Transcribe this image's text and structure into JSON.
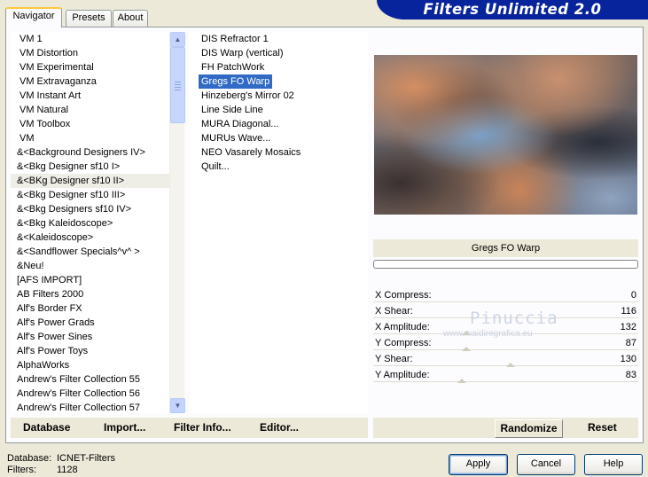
{
  "title_banner": "Filters Unlimited 2.0",
  "tabs": [
    {
      "label": "Navigator",
      "active": true
    },
    {
      "label": "Presets",
      "active": false
    },
    {
      "label": "About",
      "active": false
    }
  ],
  "categories": [
    "VM 1",
    "VM Distortion",
    "VM Experimental",
    "VM Extravaganza",
    "VM Instant Art",
    "VM Natural",
    "VM Toolbox",
    "VM",
    "&<Background Designers IV>",
    "&<Bkg Designer sf10 I>",
    "&<BKg Designer sf10 II>",
    "&<Bkg Designer sf10 III>",
    "&<Bkg Designers sf10 IV>",
    "&<Bkg Kaleidoscope>",
    "&<Kaleidoscope>",
    "&<Sandflower Specials^v^ >",
    "&Neu!",
    "[AFS IMPORT]",
    "AB Filters 2000",
    "Alf's Border FX",
    "Alf's Power Grads",
    "Alf's Power Sines",
    "Alf's Power Toys",
    "AlphaWorks",
    "Andrew's Filter Collection 55",
    "Andrew's Filter Collection 56",
    "Andrew's Filter Collection 57"
  ],
  "selected_category_index": 10,
  "filters": [
    "DIS Refractor 1",
    "DIS Warp (vertical)",
    "FH PatchWork",
    "Gregs FO Warp",
    "Hinzeberg's Mirror 02",
    "Line Side Line",
    "MURA Diagonal...",
    "MURUs Wave...",
    "NEO Vasarely Mosaics",
    "Quilt..."
  ],
  "selected_filter_index": 3,
  "current_filter_name": "Gregs FO Warp",
  "params": [
    {
      "label": "X Compress:",
      "value": "0"
    },
    {
      "label": "X Shear:",
      "value": "116"
    },
    {
      "label": "X Amplitude:",
      "value": "132"
    },
    {
      "label": "Y Compress:",
      "value": "87"
    },
    {
      "label": "Y Shear:",
      "value": "130"
    },
    {
      "label": "Y Amplitude:",
      "value": "83"
    }
  ],
  "watermark": {
    "name": "Pinuccia",
    "site": "www.maidiregrafica.eu"
  },
  "bottom_buttons": {
    "database": "Database",
    "import": "Import...",
    "filter_info": "Filter Info...",
    "editor": "Editor...",
    "randomize": "Randomize",
    "reset": "Reset"
  },
  "status": {
    "database_label": "Database:",
    "database_value": "ICNET-Filters",
    "filters_label": "Filters:",
    "filters_value": "1128"
  },
  "dialog_buttons": {
    "apply": "Apply",
    "cancel": "Cancel",
    "help": "Help"
  }
}
